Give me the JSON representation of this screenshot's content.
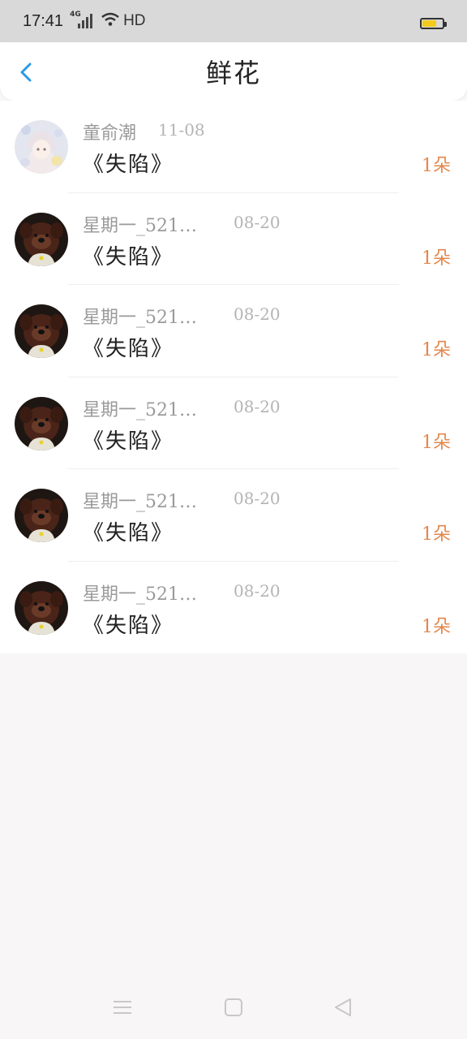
{
  "status": {
    "time": "17:41",
    "network": "4G",
    "hd": "HD"
  },
  "header": {
    "title": "鲜花"
  },
  "items": [
    {
      "name": "童俞潮",
      "date": "11-08",
      "book": "《失陷》",
      "count": "1朵",
      "avatar": "anime-girl-avatar"
    },
    {
      "name": "星期一_521…",
      "date": "08-20",
      "book": "《失陷》",
      "count": "1朵",
      "avatar": "dog-avatar"
    },
    {
      "name": "星期一_521…",
      "date": "08-20",
      "book": "《失陷》",
      "count": "1朵",
      "avatar": "dog-avatar"
    },
    {
      "name": "星期一_521…",
      "date": "08-20",
      "book": "《失陷》",
      "count": "1朵",
      "avatar": "dog-avatar"
    },
    {
      "name": "星期一_521…",
      "date": "08-20",
      "book": "《失陷》",
      "count": "1朵",
      "avatar": "dog-avatar"
    },
    {
      "name": "星期一_521…",
      "date": "08-20",
      "book": "《失陷》",
      "count": "1朵",
      "avatar": "dog-avatar"
    }
  ],
  "colors": {
    "accent": "#e3874c",
    "back": "#2a9ae6",
    "background": "#f8f6f6"
  },
  "icons": {
    "back": "chevron-left-icon",
    "menu": "menu-icon",
    "home": "square-icon",
    "nav_back": "triangle-back-icon"
  }
}
